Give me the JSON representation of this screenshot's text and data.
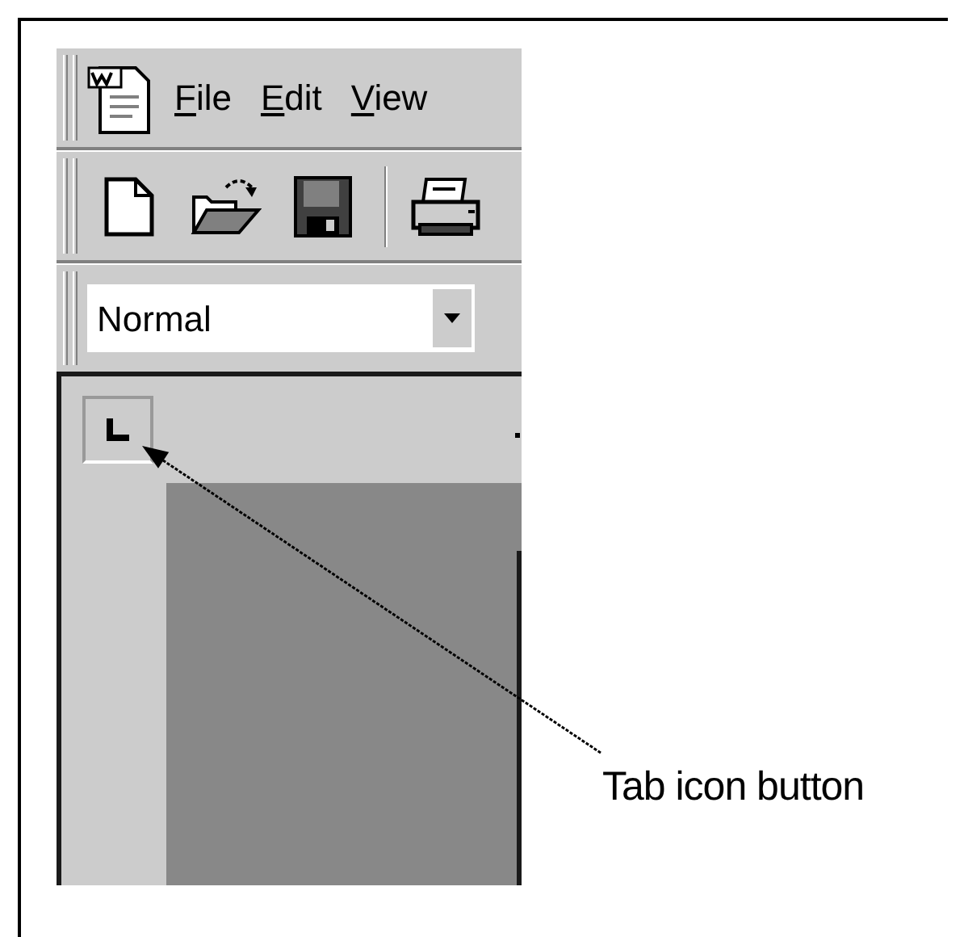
{
  "menu_bar": {
    "items": [
      {
        "label": "File"
      },
      {
        "label": "Edit"
      },
      {
        "label": "View"
      }
    ]
  },
  "formatting_toolbar": {
    "style_box": {
      "value": "Normal"
    }
  },
  "annotation": {
    "label": "Tab icon button"
  }
}
